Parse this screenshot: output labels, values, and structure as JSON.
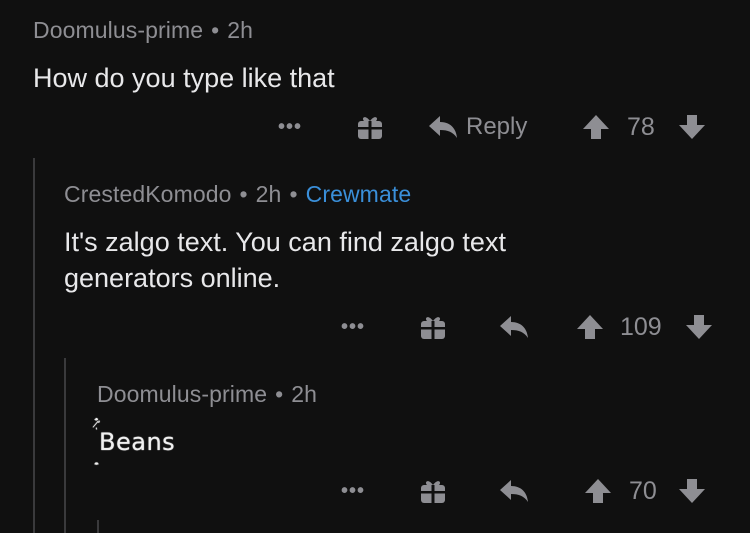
{
  "comments": [
    {
      "author": "Doomulus-prime",
      "time": "2h",
      "text": "How do you type like that",
      "reply_label": "Reply",
      "votes": "78"
    },
    {
      "author": "CrestedKomodo",
      "time": "2h",
      "flair": "Crewmate",
      "text_line1": "It's zalgo text. You can find zalgo text",
      "text_line2": "generators online.",
      "votes": "109"
    },
    {
      "author": "Doomulus-prime",
      "time": "2h",
      "text": "Beans",
      "votes": "70"
    }
  ],
  "meta_separator": "•",
  "more_label": "•••",
  "icons": {
    "more": "more-options-icon",
    "award": "gift-award-icon",
    "reply": "reply-arrow-icon",
    "upvote": "upvote-arrow-icon",
    "downvote": "downvote-arrow-icon"
  },
  "colors": {
    "background": "#101010",
    "meta": "#8e8e93",
    "text": "#e8e8ea",
    "flair": "#3a8fd9",
    "thread_line": "#3a3a3c"
  }
}
